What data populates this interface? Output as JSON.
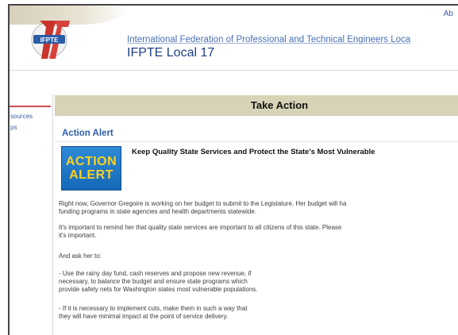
{
  "header": {
    "top_right_link": "Ab",
    "logo_number": "17",
    "logo_text": "IFPTE",
    "org_name": "International Federation of Professional and Technical Engineers Loca",
    "local_name": "IFPTE Local 17"
  },
  "sidebar": {
    "items": [
      {
        "label": "sources"
      },
      {
        "label": "ps"
      }
    ]
  },
  "main": {
    "page_title": "Take Action",
    "section_title": "Action Alert",
    "badge": {
      "line1": "ACTION",
      "line2": "ALERT"
    },
    "headline": "Keep Quality State Services and Protect the State's Most Vulnerable",
    "paragraphs": [
      "Right now, Governor Gregoire is working on her budget to submit to the Legislature. Her budget will ha",
      "funding programs in state agencies and health departments statewide.",
      "It's important to remind her that quality state services are important to all citizens of this state. Please",
      "it's important.",
      "And ask her to:",
      "- Use the rainy day fund, cash reserves and propose new revenue, if",
      "necessary, to balance the budget and ensure state programs which",
      "provide safety nets for Washington states most vulnerable populations.",
      "- If it is necessary to implement cuts, make them in such a way that",
      "they will have minimal impact at the point of service delivery."
    ]
  },
  "colors": {
    "title_bar": "#d7d3b6",
    "link_blue": "#3b5fa8",
    "badge_blue": "#1568b6",
    "badge_text": "#ffd21f",
    "logo_red": "#c8332b"
  }
}
